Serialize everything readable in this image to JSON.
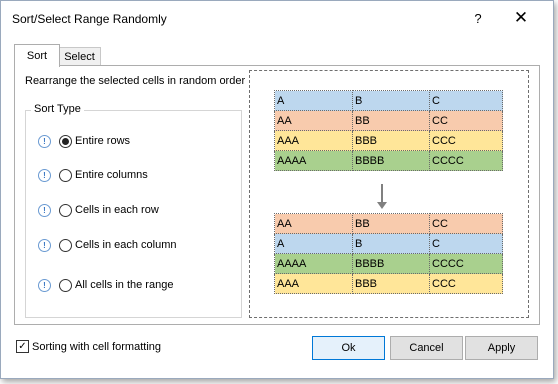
{
  "window": {
    "title": "Sort/Select Range Randomly",
    "help_glyph": "?",
    "close_glyph": "✕"
  },
  "tabs": [
    {
      "label": "Sort",
      "active": true
    },
    {
      "label": "Select",
      "active": false
    }
  ],
  "description": "Rearrange the selected cells in random order",
  "sort_type": {
    "legend": "Sort Type",
    "options": [
      {
        "label": "Entire rows",
        "checked": true
      },
      {
        "label": "Entire columns",
        "checked": false
      },
      {
        "label": "Cells in each row",
        "checked": false
      },
      {
        "label": "Cells in each column",
        "checked": false
      },
      {
        "label": "All cells in the range",
        "checked": false
      }
    ]
  },
  "preview": {
    "before": [
      {
        "cells": [
          "A",
          "B",
          "C"
        ],
        "color": "#bdd7ee"
      },
      {
        "cells": [
          "AA",
          "BB",
          "CC"
        ],
        "color": "#f8cbad"
      },
      {
        "cells": [
          "AAA",
          "BBB",
          "CCC"
        ],
        "color": "#ffe699"
      },
      {
        "cells": [
          "AAAA",
          "BBBB",
          "CCCC"
        ],
        "color": "#a9d08e"
      }
    ],
    "after": [
      {
        "cells": [
          "AA",
          "BB",
          "CC"
        ],
        "color": "#f8cbad"
      },
      {
        "cells": [
          "A",
          "B",
          "C"
        ],
        "color": "#bdd7ee"
      },
      {
        "cells": [
          "AAAA",
          "BBBB",
          "CCCC"
        ],
        "color": "#a9d08e"
      },
      {
        "cells": [
          "AAA",
          "BBB",
          "CCC"
        ],
        "color": "#ffe699"
      }
    ]
  },
  "formatting_checkbox": {
    "label": "Sorting with cell formatting",
    "checked": true
  },
  "buttons": {
    "ok": "Ok",
    "cancel": "Cancel",
    "apply": "Apply"
  },
  "icons": {
    "info": "info-icon",
    "check": "✓"
  }
}
